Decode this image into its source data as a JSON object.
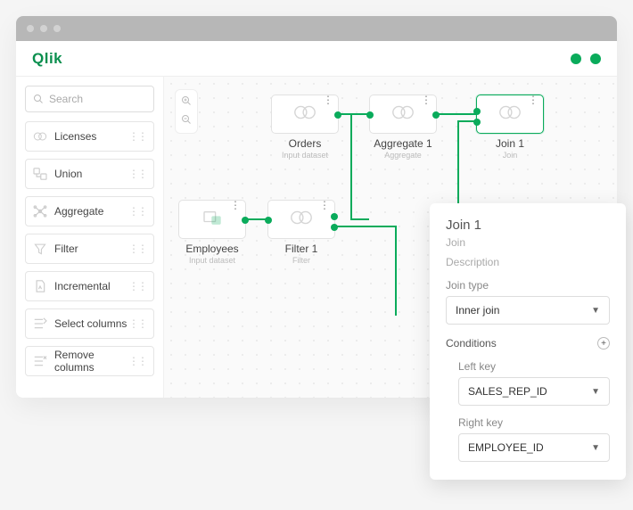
{
  "brand": "Qlik",
  "search": {
    "placeholder": "Search"
  },
  "sidebar": {
    "items": [
      {
        "label": "Licenses"
      },
      {
        "label": "Union"
      },
      {
        "label": "Aggregate"
      },
      {
        "label": "Filter"
      },
      {
        "label": "Incremental"
      },
      {
        "label": "Select columns"
      },
      {
        "label": "Remove columns"
      }
    ]
  },
  "nodes": {
    "orders": {
      "label": "Orders",
      "sub": "Input dataset"
    },
    "aggregate": {
      "label": "Aggregate 1",
      "sub": "Aggregate"
    },
    "join": {
      "label": "Join 1",
      "sub": "Join"
    },
    "employees": {
      "label": "Employees",
      "sub": "Input dataset"
    },
    "filter": {
      "label": "Filter 1",
      "sub": "Filter"
    }
  },
  "panel": {
    "title": "Join 1",
    "type": "Join",
    "description_label": "Description",
    "jointype_label": "Join type",
    "jointype_value": "Inner join",
    "conditions_label": "Conditions",
    "left_key_label": "Left key",
    "left_key_value": "SALES_REP_ID",
    "right_key_label": "Right key",
    "right_key_value": "EMPLOYEE_ID"
  }
}
